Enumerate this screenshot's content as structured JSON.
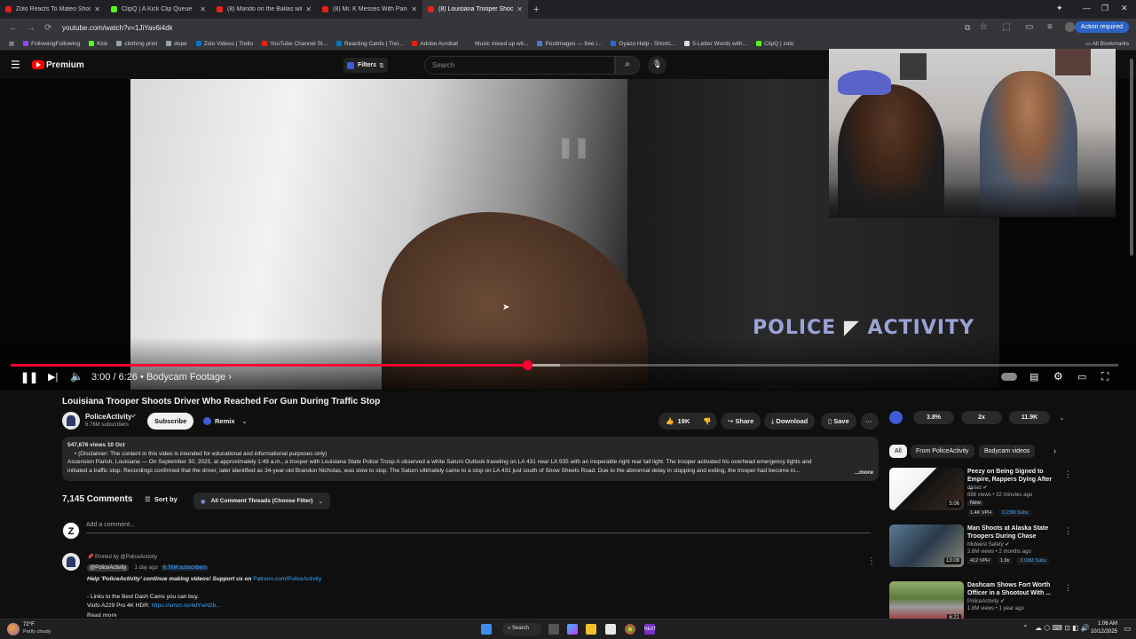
{
  "browser": {
    "tabs": [
      {
        "title": "Zolo Reacts To Mateo Shoot",
        "color": "#e62117",
        "active": false
      },
      {
        "title": "ClipQ | A Kick Clip Queue",
        "color": "#53fc18",
        "active": false
      },
      {
        "title": "(8) Mando on the Ballas withoi",
        "color": "#e62117",
        "active": false
      },
      {
        "title": "(8) Mr. K Messes With Paris in",
        "color": "#e62117",
        "active": false
      },
      {
        "title": "(8) Louisiana Trooper Shoot",
        "color": "#e62117",
        "active": true
      }
    ],
    "url": "youtube.com/watch?v=1JiYav6i4dk",
    "action_required": "Action required",
    "bookmarks": [
      {
        "label": "FollowingFollowing",
        "color": "#9146ff"
      },
      {
        "label": "Kick",
        "color": "#53fc18"
      },
      {
        "label": "clothing print",
        "color": "#9aa0a6"
      },
      {
        "label": "dope",
        "color": "#9aa0a6"
      },
      {
        "label": "Zolo Videos | Trello",
        "color": "#0079bf"
      },
      {
        "label": "YouTube Channel St...",
        "color": "#e62117"
      },
      {
        "label": "Reacting Cards | Trel...",
        "color": "#0079bf"
      },
      {
        "label": "Adobe Acrobat",
        "color": "#e62117"
      },
      {
        "label": "Music mixed up wit...",
        "color": "#333333"
      },
      {
        "label": "Postimages — free i...",
        "color": "#4a7bd0"
      },
      {
        "label": "Gyazo Help - Shortc...",
        "color": "#2a6bd6"
      },
      {
        "label": "5-Letter Words with...",
        "color": "#dddddd"
      },
      {
        "label": "ClipQ | zolo",
        "color": "#53fc18"
      }
    ],
    "all_bookmarks": "All Bookmarks"
  },
  "youtube": {
    "logo_text": "Premium",
    "filters_label": "Filters",
    "search_placeholder": "Search"
  },
  "player": {
    "watermark_left": "POLICE",
    "watermark_right": "ACTIVITY",
    "time": "3:00 / 6:26 • Bodycam Footage ›",
    "progress_fraction": 0.466,
    "buffer_fraction": 0.496
  },
  "video": {
    "title": "Louisiana Trooper Shoots Driver Who Reached For Gun During Traffic Stop",
    "channel": "PoliceActivity",
    "subscribers": "6.76M subscribers",
    "subscribe": "Subscribe",
    "remix": "Remix",
    "likes": "19K",
    "share": "Share",
    "download": "Download",
    "save": "Save",
    "views_date": "547,676 views  10 Oct",
    "disclaimer": "•  (Disclaimer: The content in this video is intended for educational and informational purposes only)",
    "desc_line1": "Ascension Parish, Louisiana — On September 30, 2025, at approximately 1:49 a.m., a trooper with Louisiana State Police Troop A observed a white Saturn Outlook traveling on LA 431 near LA 935 with an inoperable right rear tail light. The trooper activated his overhead emergency lights and",
    "desc_line2": "initiated a traffic stop. Recordings confirmed that the driver, later identified as 34-year-old Brandon Nicholas, was slow to stop. The Saturn ultimately came to a stop on LA 431 just south of Snow Sheets Road. Due to the abnormal delay in stopping and exiting, the trooper had become in...",
    "more": "...more"
  },
  "comments": {
    "count": "7,145 Comments",
    "sort_by": "Sort by",
    "filter": "All Comment Threads (Choose Filter)",
    "add_placeholder": "Add a comment...",
    "pinned": "Pinned by @PoliceActivity",
    "author": "@PoliceActivity",
    "age": "1 day ago",
    "author_subs": "6.76M subscribers",
    "line1_a": "Help 'PoliceActivity' continue making videos! Support us on ",
    "line1_link": "Patreon.com/PoliceActivity",
    "line2": "- Links to the Best Dash Cams you can buy.",
    "line3_a": "Viofo A229 Pro 4K HDR: ",
    "line3_link": "https://amzn.to/4dYwN2b...",
    "read_more": "Read more"
  },
  "sidebar": {
    "stats": [
      "3.8%",
      "2x",
      "11.9K"
    ],
    "chips": [
      "All",
      "From PoliceActivity",
      "Bodycam videos"
    ],
    "recs": [
      {
        "title": "Peezy on Being Signed to Empire, Rappers Dying After ...",
        "channel": "djvlad",
        "meta": "888 views • 32 minutes ago",
        "tag": "New",
        "duration": "5:06",
        "vph": "1.4K VPH",
        "extra": "",
        "subs": "6.23M Subs"
      },
      {
        "title": "Man Shoots at Alaska State Troopers During Chase",
        "channel": "Midwest Safety",
        "meta": "2.6M views • 2 months ago",
        "tag": "",
        "duration": "13:09",
        "vph": "412 VPH",
        "extra": "1.9x",
        "subs": "3.03M Subs"
      },
      {
        "title": "Dashcam Shows Fort Worth Officer in a Shootout With ...",
        "channel": "PoliceActivity",
        "meta": "1.8M views • 1 year ago",
        "tag": "",
        "duration": "6:21",
        "vph": "",
        "extra": "",
        "subs": ""
      }
    ]
  },
  "taskbar": {
    "weather_temp": "72°F",
    "weather_desc": "Partly cloudy",
    "search": "Search",
    "time": "1:06 AM",
    "date": "10/12/2025"
  }
}
